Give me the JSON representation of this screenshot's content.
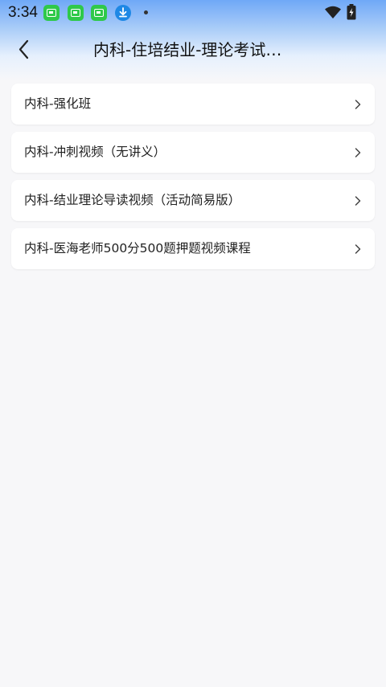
{
  "status_bar": {
    "time": "3:34"
  },
  "header": {
    "title": "内科-住培结业-理论考试…"
  },
  "icons": {
    "back": "chevron-left-icon",
    "item_arrow": "chevron-right-icon"
  },
  "list": {
    "items": [
      {
        "label": "内科-强化班"
      },
      {
        "label": "内科-冲刺视频（无讲义）"
      },
      {
        "label": "内科-结业理论导读视频（活动简易版）"
      },
      {
        "label": "内科-医海老师500分500题押题视频课程"
      }
    ]
  },
  "colors": {
    "header_gradient_top": "#6fa8f7",
    "background": "#f7f7f9",
    "card": "#ffffff",
    "notification_green": "#2fc94a",
    "download_blue": "#1e88e5"
  }
}
